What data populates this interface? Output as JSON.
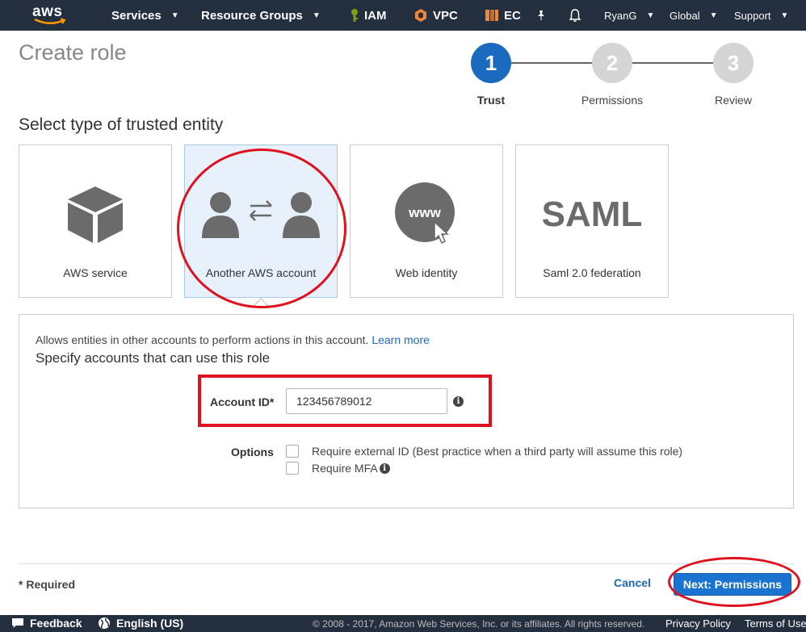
{
  "topnav": {
    "logo": "aws",
    "services": "Services",
    "resource_groups": "Resource Groups",
    "iam": "IAM",
    "vpc": "VPC",
    "ec": "EC",
    "user": "RyanG",
    "region": "Global",
    "support": "Support"
  },
  "page": {
    "title": "Create role"
  },
  "stepper": [
    {
      "number": "1",
      "label": "Trust",
      "active": true
    },
    {
      "number": "2",
      "label": "Permissions",
      "active": false
    },
    {
      "number": "3",
      "label": "Review",
      "active": false
    }
  ],
  "entity_section": {
    "heading": "Select type of trusted entity",
    "cards": [
      {
        "label": "AWS service",
        "icon": "cube-icon",
        "selected": false
      },
      {
        "label": "Another AWS account",
        "icon": "users-exchange-icon",
        "selected": true
      },
      {
        "label": "Web identity",
        "icon": "www-icon",
        "selected": false,
        "icon_text": "www"
      },
      {
        "label": "Saml 2.0 federation",
        "icon": "saml-icon",
        "selected": false,
        "icon_text": "SAML"
      }
    ]
  },
  "details": {
    "description": "Allows entities in other accounts to perform actions in this account.",
    "learn_more": "Learn more",
    "subheading": "Specify accounts that can use this role",
    "account_id_label": "Account ID*",
    "account_id_value": "123456789012",
    "options_label": "Options",
    "option_external_id": "Require external ID (Best practice when a third party will assume this role)",
    "option_mfa": "Require MFA"
  },
  "footer": {
    "required_note": "* Required",
    "cancel": "Cancel",
    "next": "Next: Permissions"
  },
  "bottombar": {
    "feedback": "Feedback",
    "language": "English (US)",
    "copyright": "© 2008 - 2017, Amazon Web Services, Inc. or its affiliates. All rights reserved.",
    "privacy": "Privacy Policy",
    "terms": "Terms of Use"
  },
  "colors": {
    "nav_bg": "#232f3e",
    "accent_blue": "#1a6bbf",
    "selected_card_bg": "#e6f1fc",
    "annotation_red": "#e0101e"
  }
}
